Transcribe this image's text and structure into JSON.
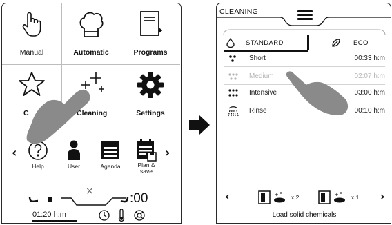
{
  "screen1": {
    "tiles": [
      {
        "label": "Manual",
        "icon": "hand-pointer-icon"
      },
      {
        "label": "Automatic",
        "icon": "chef-hat-icon"
      },
      {
        "label": "Programs",
        "icon": "recipe-book-icon"
      },
      {
        "label": "C",
        "icon": "star-icon"
      },
      {
        "label": "Cleaning",
        "icon": "sparkle-icon"
      },
      {
        "label": "Settings",
        "icon": "gear-icon"
      }
    ],
    "favorites": [
      {
        "label": "Help",
        "icon": "help-icon"
      },
      {
        "label": "User",
        "icon": "user-icon"
      },
      {
        "label": "Agenda",
        "icon": "agenda-icon"
      },
      {
        "label": "Plan &\nsave",
        "icon": "plan-save-icon"
      }
    ],
    "nav_prev": "‹",
    "nav_next": "›",
    "close": "×",
    "time": "01:20 h:m",
    "big_time": ":00"
  },
  "screen2": {
    "title": "CLEANING",
    "tabs": [
      {
        "label": "STANDARD",
        "icon": "water-drop-icon",
        "active": true
      },
      {
        "label": "ECO",
        "icon": "leaf-icon",
        "active": false
      }
    ],
    "programs": [
      {
        "name": "Short",
        "time": "00:33 h:m",
        "icon": "drops-small-icon",
        "enabled": true
      },
      {
        "name": "Medium",
        "time": "02:07 h:m",
        "icon": "drops-medium-icon",
        "enabled": false
      },
      {
        "name": "Intensive",
        "time": "03:00 h:m",
        "icon": "drops-large-icon",
        "enabled": true
      },
      {
        "name": "Rinse",
        "time": "00:10 h:m",
        "icon": "shower-icon",
        "enabled": true
      }
    ],
    "chemicals": {
      "nav_prev": "‹",
      "nav_next": "›",
      "count1": "x 2",
      "count2": "x 1",
      "label": "Load solid chemicals"
    }
  },
  "colors": {
    "line": "#2a2a2a",
    "separator": "#bdbdbd",
    "disabled": "#b5b5b5",
    "hand": "#8a8a8a"
  }
}
